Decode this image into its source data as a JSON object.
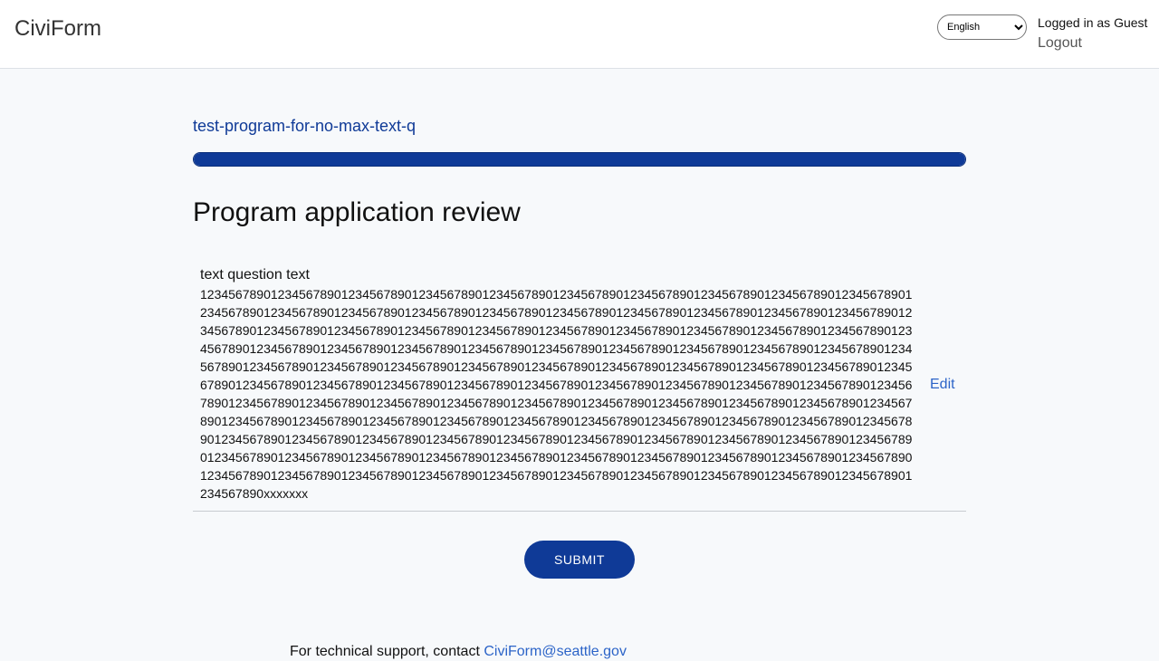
{
  "header": {
    "brand": "CiviForm",
    "language": {
      "selected": "English",
      "options": [
        "English"
      ]
    },
    "logged_in_text": "Logged in as Guest",
    "logout_label": "Logout"
  },
  "program": {
    "name": "test-program-for-no-max-text-q",
    "progress_percent": 100
  },
  "page": {
    "title": "Program application review"
  },
  "review": {
    "items": [
      {
        "question": "text question text",
        "answer": "1234567890123456789012345678901234567890123456789012345678901234567890123456789012345678901234567890123456789012345678901234567890123456789012345678901234567890123456789012345678901234567890123456789012345678901234567890123456789012345678901234567890123456789012345678901234567890123456789012345678901234567890123456789012345678901234567890123456789012345678901234567890123456789012345678901234567890123456789012345678901234567890123456789012345678901234567890123456789012345678901234567890123456789012345678901234567890123456789012345678901234567890123456789012345678901234567890123456789012345678901234567890123456789012345678901234567890123456789012345678901234567890123456789012345678901234567890123456789012345678901234567890123456789012345678901234567890123456789012345678901234567890123456789012345678901234567890123456789012345678901234567890123456789012345678901234567890123456789012345678901234567890123456789012345678901234567890123456789012345678901234567890123456789012345678901234567890123456789012345678901234567890123456789012345678901234567890123456789012345678901234567890123456789012345678901234567890xxxxxxx",
        "edit_label": "Edit"
      }
    ]
  },
  "submit": {
    "label": "SUBMIT"
  },
  "footer": {
    "text": "For technical support, contact ",
    "email": "CiviForm@seattle.gov"
  },
  "colors": {
    "primary": "#0f3a97",
    "link": "#2c64c8",
    "background": "#f7f9fb"
  }
}
